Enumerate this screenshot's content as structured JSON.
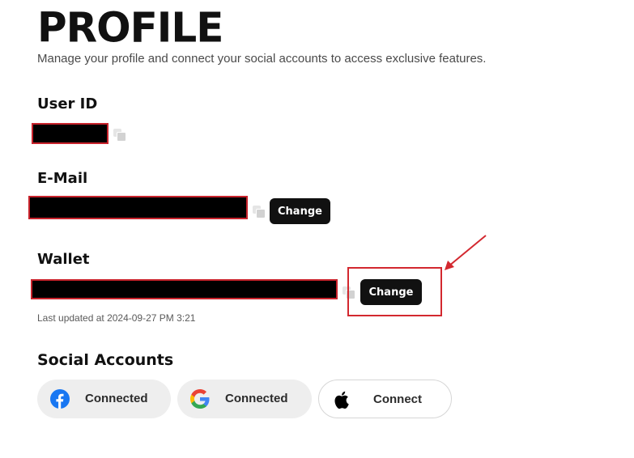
{
  "header": {
    "title": "PROFILE",
    "subtitle": "Manage your profile and connect your social accounts to access exclusive features."
  },
  "user_id": {
    "label": "User ID"
  },
  "email": {
    "label": "E-Mail",
    "change_label": "Change"
  },
  "wallet": {
    "label": "Wallet",
    "change_label": "Change",
    "last_updated": "Last updated at 2024-09-27 PM 3:21"
  },
  "social": {
    "title": "Social Accounts",
    "accounts": [
      {
        "provider": "facebook",
        "icon": "facebook-icon",
        "status": "Connected"
      },
      {
        "provider": "google",
        "icon": "google-icon",
        "status": "Connected"
      },
      {
        "provider": "apple",
        "icon": "apple-icon",
        "status": "Connect"
      }
    ]
  },
  "colors": {
    "annotation_red": "#d3282f",
    "button_dark": "#111111",
    "facebook_blue": "#1877f2"
  }
}
